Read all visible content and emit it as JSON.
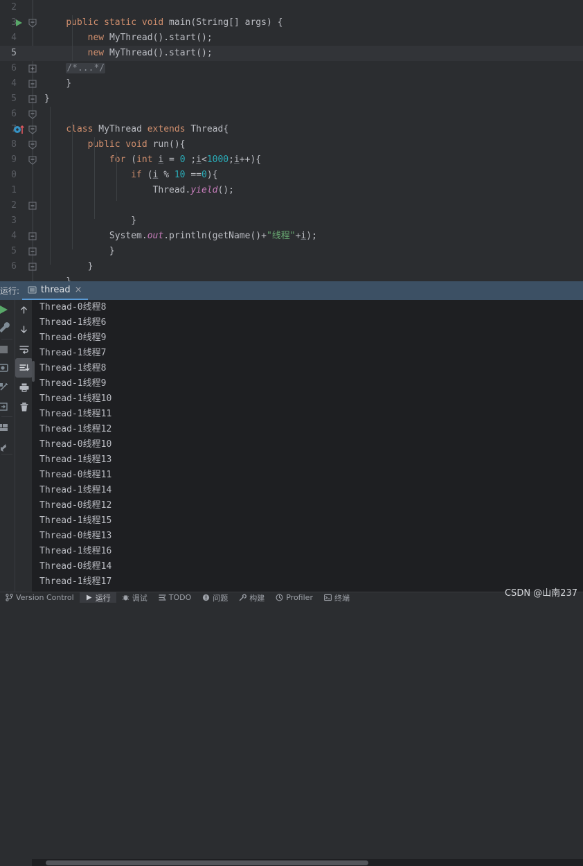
{
  "editor": {
    "language": "java",
    "background": "#2B2D30",
    "current_line_background": "#323438",
    "colors": {
      "keyword": "#CF8E6D",
      "number": "#2AACB8",
      "string": "#6AAB73",
      "static_field": "#C77DBB",
      "text": "#BCBEC4",
      "line_number": "#5A5D63",
      "folded_comment_bg": "#3B3E43"
    },
    "lines": [
      {
        "num": "2",
        "text": "",
        "current": false,
        "marker": "",
        "fold": ""
      },
      {
        "num": "3",
        "text": "    public static void main(String[] args) {",
        "current": false,
        "marker": "run-gutter-icon",
        "fold": "collapse"
      },
      {
        "num": "4",
        "text": "        new MyThread().start();",
        "current": false,
        "marker": "",
        "fold": ""
      },
      {
        "num": "5",
        "text": "        new MyThread().start();",
        "current": true,
        "marker": "",
        "fold": ""
      },
      {
        "num": "6",
        "text": "    /*...*/",
        "current": false,
        "marker": "",
        "fold": "expand"
      },
      {
        "num": "4",
        "text": "    }",
        "current": false,
        "marker": "",
        "fold": "collapse-end"
      },
      {
        "num": "5",
        "text": "}",
        "current": false,
        "marker": "",
        "fold": "collapse-end"
      },
      {
        "num": "6",
        "text": "",
        "current": false,
        "marker": "",
        "fold": "collapse"
      },
      {
        "num": "7",
        "text": "    class MyThread extends Thread{",
        "current": false,
        "marker": "bookmark-run-icon",
        "fold": "collapse"
      },
      {
        "num": "8",
        "text": "        public void run(){",
        "current": false,
        "marker": "",
        "fold": "collapse"
      },
      {
        "num": "9",
        "text": "            for (int i = 0 ;i<1000;i++){",
        "current": false,
        "marker": "",
        "fold": "collapse"
      },
      {
        "num": "0",
        "text": "                if (i % 10 ==0){",
        "current": false,
        "marker": "",
        "fold": ""
      },
      {
        "num": "1",
        "text": "                    Thread.yield();",
        "current": false,
        "marker": "",
        "fold": ""
      },
      {
        "num": "2",
        "text": "",
        "current": false,
        "marker": "",
        "fold": "collapse-end"
      },
      {
        "num": "3",
        "text": "                }",
        "current": false,
        "marker": "",
        "fold": ""
      },
      {
        "num": "4",
        "text": "            System.out.println(getName()+\"线程\"+i);",
        "current": false,
        "marker": "",
        "fold": "collapse-end"
      },
      {
        "num": "5",
        "text": "            }",
        "current": false,
        "marker": "",
        "fold": "collapse-end"
      },
      {
        "num": "6",
        "text": "        }",
        "current": false,
        "marker": "",
        "fold": "collapse-end"
      },
      {
        "num": "",
        "text": "    }",
        "current": false,
        "marker": "",
        "fold": ""
      }
    ],
    "source_text": [
      "    public static void main(String[] args) {",
      "        new MyThread().start();",
      "        new MyThread().start();",
      "    /*...*/",
      "    }",
      "}",
      "",
      "    class MyThread extends Thread{",
      "        public void run(){",
      "            for (int i = 0 ;i<1000;i++){",
      "                if (i % 10 ==0){",
      "                    Thread.yield();",
      "",
      "                }",
      "            System.out.println(getName()+\"线程\"+i);",
      "            }",
      "        }",
      "    }"
    ]
  },
  "run_window": {
    "title": "运行:",
    "tab": {
      "label": "thread",
      "close": "×",
      "icon": "java-class-icon",
      "active_underline": "#5B9BD5"
    },
    "header_background": "#3C5064",
    "toolbar_left": [
      {
        "name": "rerun-button",
        "icon": "play-icon"
      },
      {
        "name": "run-settings-button",
        "icon": "wrench-icon"
      },
      {
        "name": "stop-button",
        "icon": "stop-icon"
      },
      {
        "name": "screenshot-button",
        "icon": "camera-icon"
      },
      {
        "name": "profiler-button",
        "icon": "profiler-icon"
      },
      {
        "name": "export-button",
        "icon": "export-icon"
      },
      {
        "name": "layout-button",
        "icon": "layout-icon"
      },
      {
        "name": "pin-button",
        "icon": "pin-icon"
      }
    ],
    "toolbar_console": [
      {
        "name": "up-button",
        "icon": "arrow-up-icon",
        "selected": false
      },
      {
        "name": "down-button",
        "icon": "arrow-down-icon",
        "selected": false
      },
      {
        "name": "soft-wrap-button",
        "icon": "soft-wrap-icon",
        "selected": false
      },
      {
        "name": "scroll-to-end-button",
        "icon": "scroll-to-end-icon",
        "selected": true
      },
      {
        "name": "print-button",
        "icon": "print-icon",
        "selected": false
      },
      {
        "name": "clear-all-button",
        "icon": "trash-icon",
        "selected": false
      }
    ],
    "console": {
      "background": "#1E1F22",
      "text_color": "#BCBEC4",
      "lines": [
        "Thread-0线程8",
        "Thread-1线程6",
        "Thread-0线程9",
        "Thread-1线程7",
        "Thread-1线程8",
        "Thread-1线程9",
        "Thread-1线程10",
        "Thread-1线程11",
        "Thread-1线程12",
        "Thread-0线程10",
        "Thread-1线程13",
        "Thread-0线程11",
        "Thread-1线程14",
        "Thread-0线程12",
        "Thread-1线程15",
        "Thread-0线程13",
        "Thread-1线程16",
        "Thread-0线程14",
        "Thread-1线程17"
      ]
    }
  },
  "bottom_bar": {
    "items": [
      {
        "label": "Version Control",
        "icon": "branch-icon",
        "active": false
      },
      {
        "label": "运行",
        "icon": "play-icon",
        "active": true
      },
      {
        "label": "调试",
        "icon": "bug-icon",
        "active": false
      },
      {
        "label": "TODO",
        "icon": "todo-icon",
        "active": false
      },
      {
        "label": "问题",
        "icon": "warning-icon",
        "active": false
      },
      {
        "label": "构建",
        "icon": "hammer-icon",
        "active": false
      },
      {
        "label": "Profiler",
        "icon": "gauge-icon",
        "active": false
      },
      {
        "label": "终端",
        "icon": "terminal-icon",
        "active": false
      }
    ]
  },
  "watermark": {
    "text": "CSDN @山南237"
  }
}
